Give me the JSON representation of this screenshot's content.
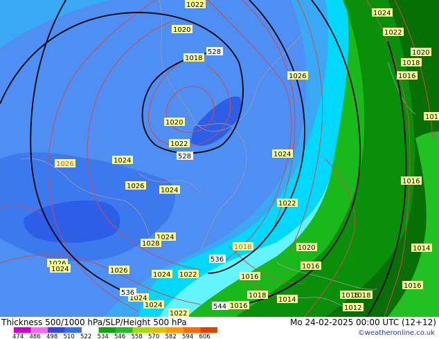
{
  "header": {
    "title": "Thickness 500/1000 hPa/SLP/Height 500 hPa",
    "datetime": "Mo 24-02-2025 00:00 UTC (12+12)",
    "credit": "©weatheronline.co.uk"
  },
  "legend": {
    "labels": [
      "474",
      "486",
      "498",
      "510",
      "522",
      "534",
      "546",
      "558",
      "570",
      "582",
      "594",
      "606"
    ],
    "colors": [
      "#cc00cc",
      "#ff66ff",
      "#3344ee",
      "#3a6ef0",
      "#ffffff",
      "#16a016",
      "#22c022",
      "#a0e000",
      "#e0c000",
      "#ff9a00",
      "#ff6a00",
      "#e04000"
    ]
  },
  "colors": {
    "thickness_510": "#2c5ee8",
    "thickness_522": "#4f8ef2",
    "thickness_528": "#3aa8f5",
    "thickness_534": "#00d8ff",
    "thickness_540": "#64f4ff",
    "thickness_546": "#1bb81b",
    "thickness_552": "#0a8f0a",
    "thickness_558": "#067006",
    "isobar": "#d24a4a",
    "height_contour": "#000000",
    "coast": "#a0a0a0",
    "label_bg": "#ffff99"
  },
  "isobar_labels": [
    {
      "text": "1022"
    },
    {
      "text": "1020"
    },
    {
      "text": "1018"
    },
    {
      "text": "1026"
    },
    {
      "text": "1020"
    },
    {
      "text": "1022"
    },
    {
      "text": "1026"
    },
    {
      "text": "1024"
    },
    {
      "text": "1026"
    },
    {
      "text": "1024"
    },
    {
      "text": "1024"
    },
    {
      "text": "1022"
    },
    {
      "text": "1024"
    },
    {
      "text": "1028"
    },
    {
      "text": "1026"
    },
    {
      "text": "1024"
    },
    {
      "text": "1026"
    },
    {
      "text": "1024"
    },
    {
      "text": "1022"
    },
    {
      "text": "1024"
    },
    {
      "text": "1024"
    },
    {
      "text": "1022"
    },
    {
      "text": "1018"
    },
    {
      "text": "1016"
    },
    {
      "text": "1020"
    },
    {
      "text": "1016"
    },
    {
      "text": "1018"
    },
    {
      "text": "1014"
    },
    {
      "text": "1016"
    },
    {
      "text": "1024"
    },
    {
      "text": "1022"
    },
    {
      "text": "1020"
    },
    {
      "text": "1018"
    },
    {
      "text": "1016"
    },
    {
      "text": "101"
    },
    {
      "text": "1016"
    },
    {
      "text": "1014"
    },
    {
      "text": "1016"
    },
    {
      "text": "1018"
    },
    {
      "text": "1016"
    },
    {
      "text": "1012"
    }
  ],
  "height_labels": [
    {
      "text": "528"
    },
    {
      "text": "528"
    },
    {
      "text": "536"
    },
    {
      "text": "536"
    },
    {
      "text": "544"
    }
  ]
}
